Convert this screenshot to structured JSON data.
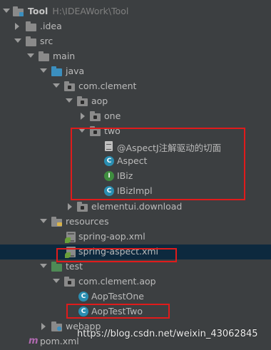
{
  "colors": {
    "background": "#3c3f41",
    "selection": "#0d293e",
    "folder_gray": "#8a8a8a",
    "folder_source": "#3b8fbf",
    "folder_test": "#4e8a55",
    "class_blue": "#2a8eb1",
    "interface_green": "#3f8d3f",
    "highlight_box": "#e01b1b"
  },
  "tree": {
    "root_name": "Tool",
    "root_path": "H:\\IDEAWork\\Tool",
    "idea": ".idea",
    "src": "src",
    "main": "main",
    "java": "java",
    "com_clement": "com.clement",
    "aop": "aop",
    "one": "one",
    "two": "two",
    "two_readme": "@AspectJ注解驱动的切面",
    "aspect": "Aspect",
    "ibiz": "IBiz",
    "ibizimpl": "IBizImpl",
    "elementui": "elementui.download",
    "resources": "resources",
    "spring_aop_xml": "spring-aop.xml",
    "spring_aspect_xml": "spring-aspect.xml",
    "test": "test",
    "com_clement_aop": "com.clement.aop",
    "aop_test_one": "AopTestOne",
    "aop_test_two": "AopTestTwo",
    "webapp": "webapp",
    "pom": "pom.xml"
  },
  "icons": {
    "class_letter": "C",
    "interface_letter": "I",
    "maven_letter": "m"
  },
  "watermark": "https://blog.csdn.net/weixin_43062845"
}
